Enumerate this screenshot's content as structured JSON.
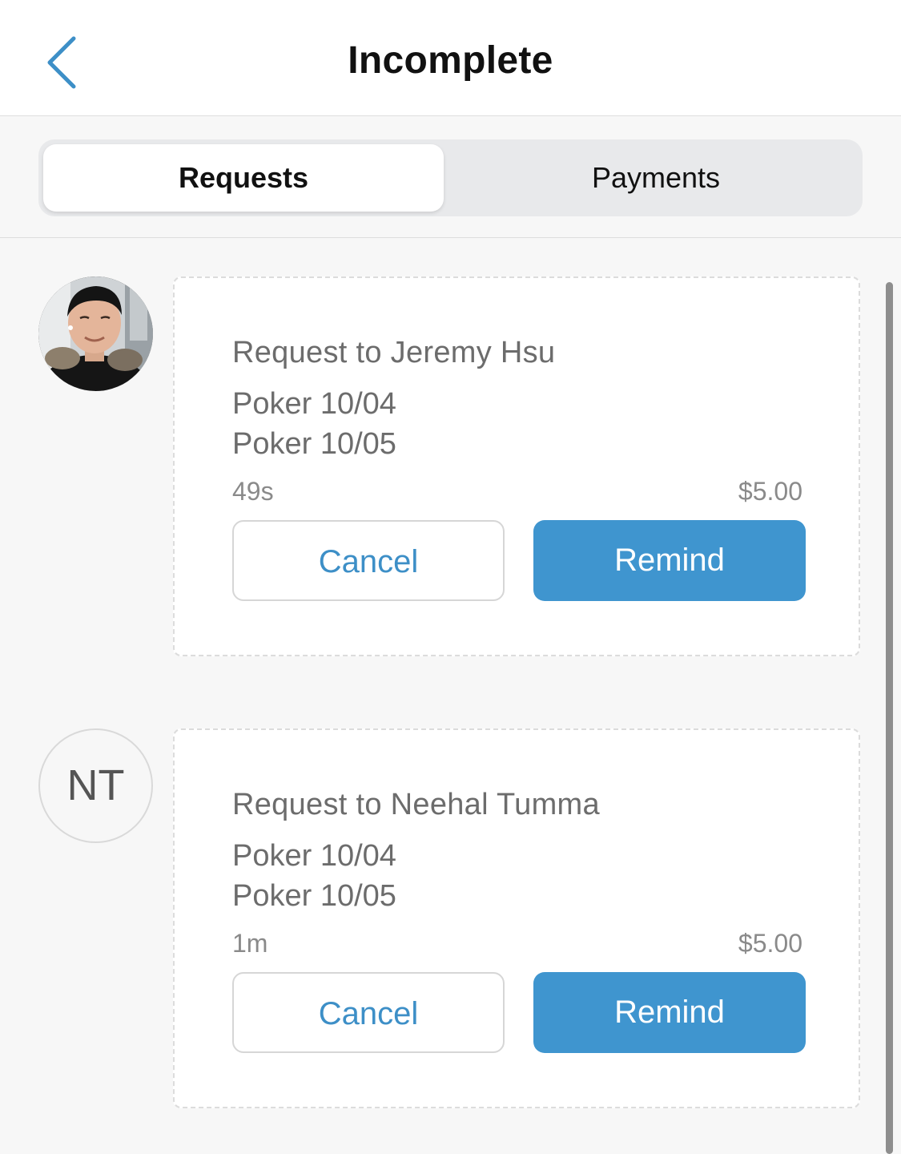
{
  "header": {
    "title": "Incomplete",
    "back_icon": "chevron-left-icon"
  },
  "tabs": [
    {
      "label": "Requests",
      "active": true
    },
    {
      "label": "Payments",
      "active": false
    }
  ],
  "colors": {
    "accent": "#3f95cf",
    "accent_text": "#3d8fc7"
  },
  "requests": [
    {
      "avatar": "photo",
      "title": "Request to Jeremy Hsu",
      "items": [
        "Poker 10/04",
        "Poker 10/05"
      ],
      "time": "49s",
      "amount": "$5.00",
      "cancel_label": "Cancel",
      "remind_label": "Remind"
    },
    {
      "avatar_initials": "NT",
      "title": "Request to Neehal Tumma",
      "items": [
        "Poker 10/04",
        "Poker 10/05"
      ],
      "time": "1m",
      "amount": "$5.00",
      "cancel_label": "Cancel",
      "remind_label": "Remind"
    }
  ]
}
